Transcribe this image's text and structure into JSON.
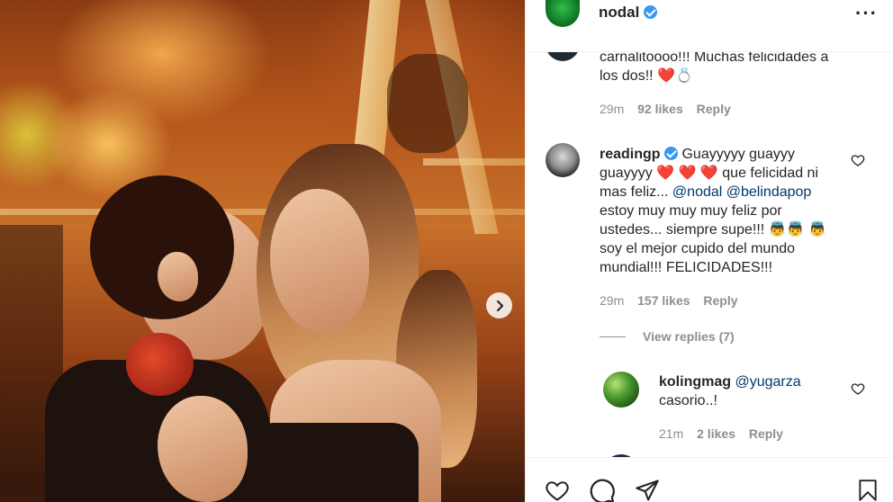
{
  "post": {
    "username": "nodal",
    "more_icon": "more-options-icon"
  },
  "comments": [
    {
      "text_before": "carnalitoooo!!! Muchas felicidades a los dos!!",
      "emojis": "❤️💍",
      "time": "29m",
      "likes": "92 likes",
      "reply": "Reply"
    },
    {
      "username": "readingp",
      "text_1": "Guayyyyy guayyy guayyyy",
      "hearts": "❤️ ❤️ ❤️",
      "text_2": "que felicidad ni mas feliz...",
      "mention_1": "@nodal",
      "mention_2": "@belindapop",
      "text_3": "estoy muy muy muy feliz por ustedes... siempre supe!!!",
      "emoji_cupids": "👼👼",
      "emoji_cupid_single": "👼",
      "text_4": "soy el mejor cupido del mundo mundial!!! FELICIDADES!!!",
      "time": "29m",
      "likes": "157 likes",
      "reply": "Reply",
      "view_replies": "View replies (7)"
    },
    {
      "username": "kolingmag",
      "mention": "@yugarza",
      "text": "casorio..!",
      "time": "21m",
      "likes": "2 likes",
      "reply": "Reply"
    }
  ],
  "actions": [
    "heart-icon",
    "comment-icon",
    "share-icon",
    "bookmark-icon"
  ],
  "colors": {
    "verified": "#3897f0",
    "mention": "#00376b",
    "meta": "#8e8e8e",
    "heart": "#e0112b"
  }
}
